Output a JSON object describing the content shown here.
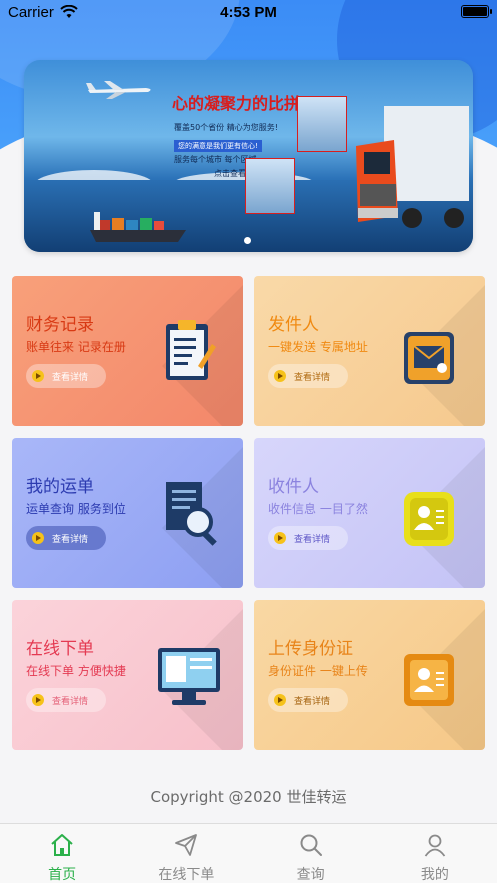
{
  "status_bar": {
    "carrier": "Carrier",
    "time": "4:53 PM"
  },
  "banner": {
    "headline": "心的凝聚力的比拼",
    "line1": "覆盖50个省份  精心为您服务!",
    "tag": "您的满意是我们更有信心!",
    "line2": "服务每个城市  每个区域",
    "line3": "点击查看>>",
    "active_slide": 1,
    "slide_count": 1
  },
  "cards": [
    {
      "title": "财务记录",
      "subtitle": "账单往来  记录在册",
      "button": "查看详情",
      "icon": "clipboard-icon"
    },
    {
      "title": "发件人",
      "subtitle": "一键发送  专属地址",
      "button": "查看详情",
      "icon": "mail-icon"
    },
    {
      "title": "我的运单",
      "subtitle": "运单查询  服务到位",
      "button": "查看详情",
      "icon": "document-search-icon"
    },
    {
      "title": "收件人",
      "subtitle": "收件信息  一目了然",
      "button": "查看详情",
      "icon": "contact-card-icon"
    },
    {
      "title": "在线下单",
      "subtitle": "在线下单  方便快捷",
      "button": "查看详情",
      "icon": "monitor-icon"
    },
    {
      "title": "上传身份证",
      "subtitle": "身份证件  一键上传",
      "button": "查看详情",
      "icon": "id-card-icon"
    }
  ],
  "copyright": "Copyright @2020 世佳转运",
  "tabbar": {
    "active": "首页",
    "items": [
      {
        "label": "首页",
        "icon": "home-icon"
      },
      {
        "label": "在线下单",
        "icon": "send-icon"
      },
      {
        "label": "查询",
        "icon": "search-icon"
      },
      {
        "label": "我的",
        "icon": "user-icon"
      }
    ]
  },
  "colors": {
    "accent_green": "#2bb04a",
    "header_blue": "#3b8cf6"
  }
}
